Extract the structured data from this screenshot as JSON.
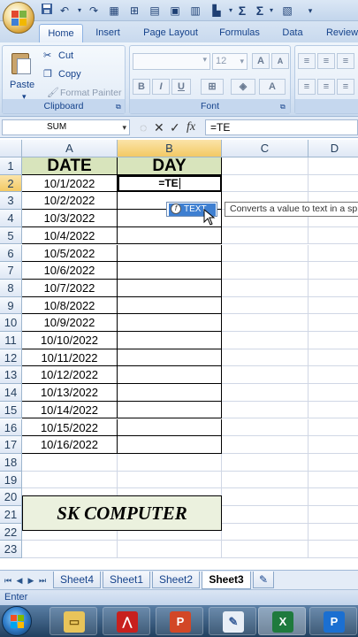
{
  "tabs": [
    "Home",
    "Insert",
    "Page Layout",
    "Formulas",
    "Data",
    "Review"
  ],
  "clipboard": {
    "paste": "Paste",
    "cut": "Cut",
    "copy": "Copy",
    "format_painter": "Format Painter",
    "label": "Clipboard"
  },
  "font_group": {
    "font_size": "12",
    "label": "Font",
    "bold": "B",
    "italic": "I",
    "underline": "U"
  },
  "formula_bar": {
    "name_box": "SUM",
    "value": "=TE"
  },
  "columns": [
    "A",
    "B",
    "C",
    "D"
  ],
  "rows": [
    "1",
    "2",
    "3",
    "4",
    "5",
    "6",
    "7",
    "8",
    "9",
    "10",
    "11",
    "12",
    "13",
    "14",
    "15",
    "16",
    "17",
    "18",
    "19",
    "20",
    "21",
    "22",
    "23"
  ],
  "headers": {
    "date": "DATE",
    "day": "DAY"
  },
  "dates": [
    "10/1/2022",
    "10/2/2022",
    "10/3/2022",
    "10/4/2022",
    "10/5/2022",
    "10/6/2022",
    "10/7/2022",
    "10/8/2022",
    "10/9/2022",
    "10/10/2022",
    "10/11/2022",
    "10/12/2022",
    "10/13/2022",
    "10/14/2022",
    "10/15/2022",
    "10/16/2022"
  ],
  "editing_cell": "=TE",
  "autocomplete": {
    "item": "TEXT",
    "tooltip": "Converts a value to text in a sp"
  },
  "banner": "SK COMPUTER",
  "sheets": [
    "Sheet4",
    "Sheet1",
    "Sheet2",
    "Sheet3"
  ],
  "active_sheet": "Sheet3",
  "status": "Enter",
  "colors": {
    "header_fill": "#d8e4bc",
    "banner_fill": "#ebf1de",
    "ribbon": "#dde8f5",
    "selection": "#f3c964"
  }
}
